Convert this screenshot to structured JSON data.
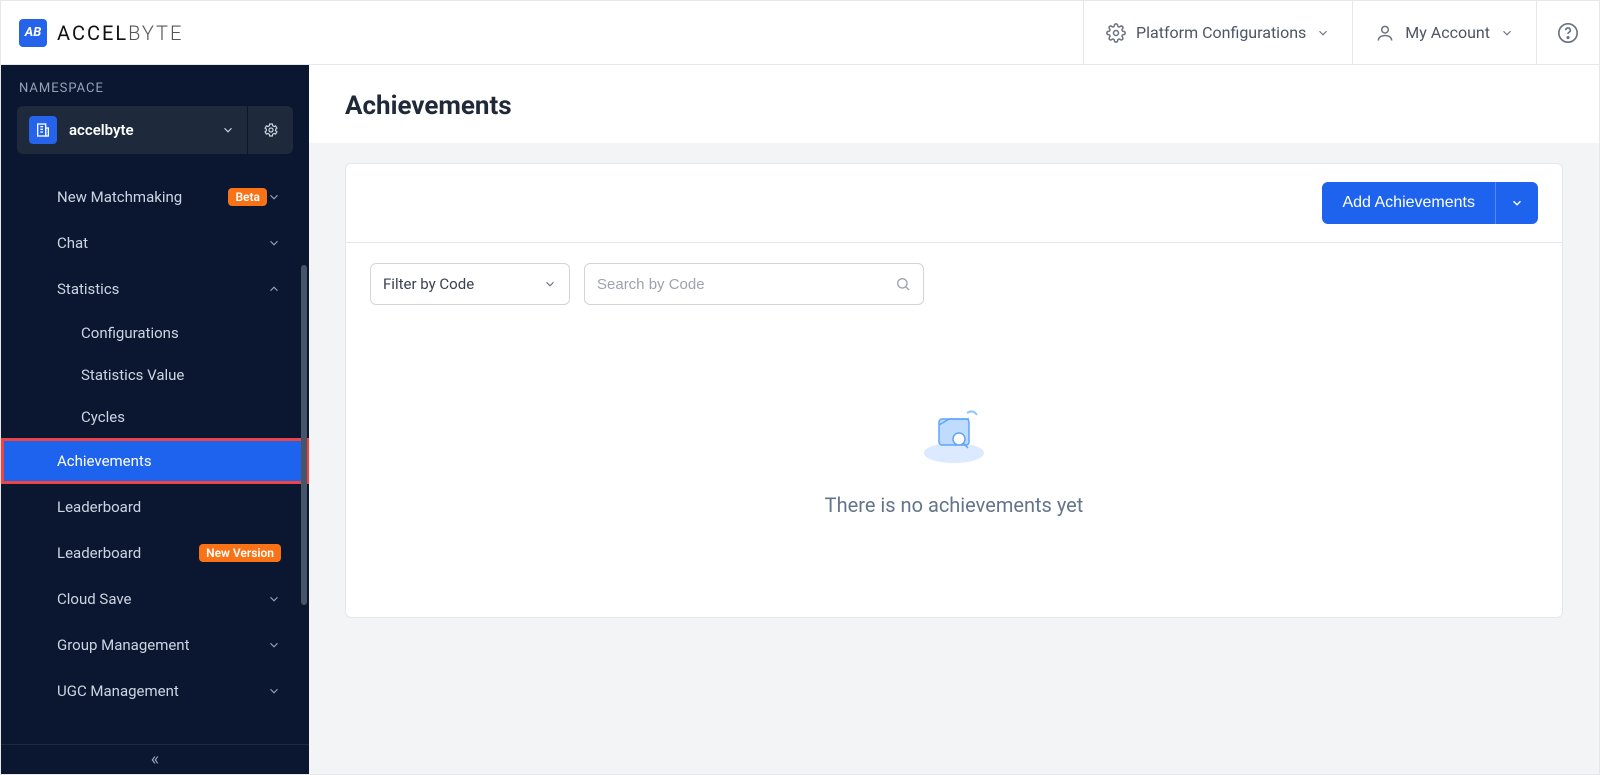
{
  "brand": {
    "logo_text": "AB",
    "name_span1": "ACCEL",
    "name_span2": "BYTE"
  },
  "header": {
    "platform_config": "Platform Configurations",
    "account": "My Account"
  },
  "sidebar": {
    "namespace_label": "NAMESPACE",
    "namespace": "accelbyte",
    "items": [
      {
        "label": "New Matchmaking",
        "badge": "Beta",
        "expand": "down"
      },
      {
        "label": "Chat",
        "expand": "down"
      },
      {
        "label": "Statistics",
        "expand": "up"
      },
      {
        "label": "Configurations",
        "sub": true
      },
      {
        "label": "Statistics Value",
        "sub": true
      },
      {
        "label": "Cycles",
        "sub": true
      },
      {
        "label": "Achievements",
        "active": true,
        "highlight": true
      },
      {
        "label": "Leaderboard"
      },
      {
        "label": "Leaderboard",
        "badge": "New Version"
      },
      {
        "label": "Cloud Save",
        "expand": "down"
      },
      {
        "label": "Group Management",
        "expand": "down"
      },
      {
        "label": "UGC Management",
        "expand": "down"
      }
    ]
  },
  "page": {
    "title": "Achievements",
    "add_button": "Add Achievements",
    "filter_label": "Filter by Code",
    "search_placeholder": "Search by Code",
    "empty_text": "There is no achievements yet"
  }
}
